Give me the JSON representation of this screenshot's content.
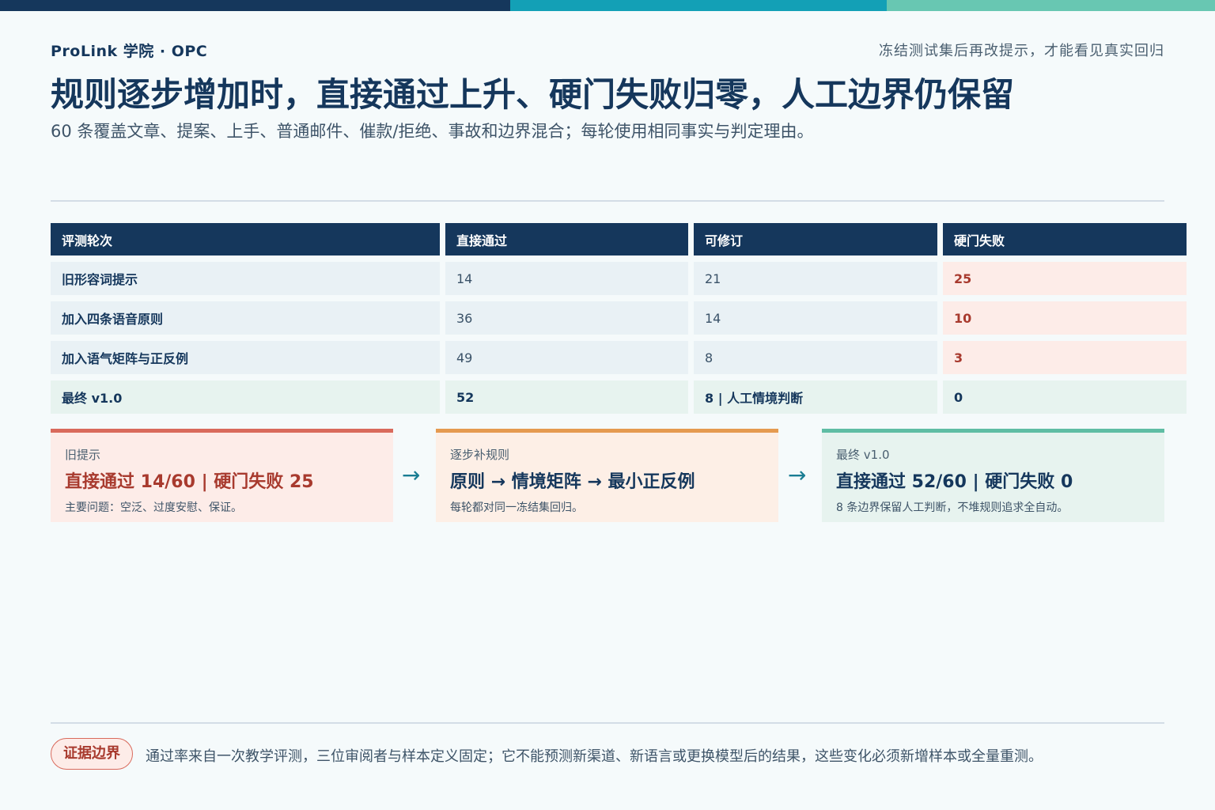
{
  "header": {
    "brand": "ProLink 学院 · OPC",
    "hint": "冻结测试集后再改提示，才能看见真实回归",
    "title": "规则逐步增加时，直接通过上升、硬门失败归零，人工边界仍保留",
    "subtitle": "60 条覆盖文章、提案、上手、普通邮件、催款/拒绝、事故和边界混合；每轮使用相同事实与判定理由。"
  },
  "table": {
    "headers": [
      "评测轮次",
      "直接通过",
      "可修订",
      "硬门失败"
    ],
    "rows": [
      [
        "旧形容词提示",
        "14",
        "21",
        "25"
      ],
      [
        "加入四条语音原则",
        "36",
        "14",
        "10"
      ],
      [
        "加入语气矩阵与正反例",
        "49",
        "8",
        "3"
      ],
      [
        "最终 v1.0",
        "52",
        "8 | 人工情境判断",
        "0"
      ]
    ]
  },
  "cards": [
    {
      "label": "旧提示",
      "headline": "直接通过 14/60 | 硬门失败 25",
      "note": "主要问题：空泛、过度安慰、保证。"
    },
    {
      "label": "逐步补规则",
      "headline": "原则 → 情境矩阵 → 最小正反例",
      "note": "每轮都对同一冻结集回归。"
    },
    {
      "label": "最终 v1.0",
      "headline": "直接通过 52/60 | 硬门失败 0",
      "note": "8 条边界保留人工判断，不堆规则追求全自动。"
    }
  ],
  "arrows": [
    "→",
    "→"
  ],
  "footer": {
    "badge": "证据边界",
    "note": "通过率来自一次教学评测，三位审阅者与样本定义固定；它不能预测新渠道、新语言或更换模型后的结果，这些变化必须新增样本或全量重测。"
  },
  "colors": {
    "navy": "#15375c",
    "teal": "#13a0b6",
    "mint": "#68c7b2",
    "fail_red": "#a83a2e",
    "fail_bg": "#fdece8",
    "pass_bg": "#e7f3ef"
  }
}
